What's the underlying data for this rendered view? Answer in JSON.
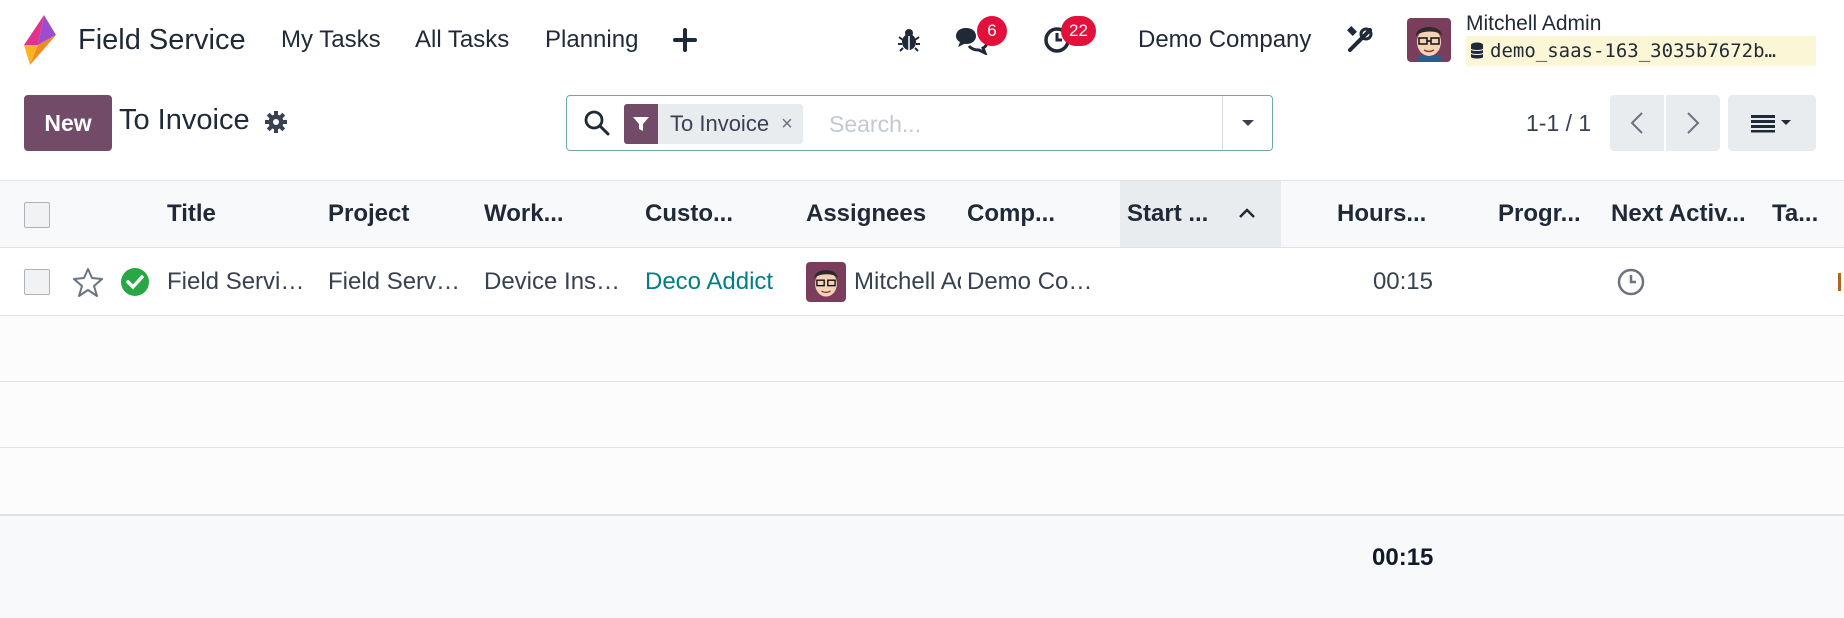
{
  "navbar": {
    "app_name": "Field Service",
    "menu": [
      "My Tasks",
      "All Tasks",
      "Planning"
    ],
    "messages_count": "6",
    "activities_count": "22",
    "company": "Demo Company",
    "user_name": "Mitchell Admin",
    "database": "demo_saas-163_3035b7672b…"
  },
  "control": {
    "new_label": "New",
    "title": "To Invoice",
    "facet_label": "To Invoice",
    "facet_remove": "×",
    "search_placeholder": "Search...",
    "pager": "1-1 / 1"
  },
  "list": {
    "columns": [
      "Title",
      "Project",
      "Work...",
      "Custo...",
      "Assignees",
      "Comp...",
      "Start ...",
      "Hours...",
      "Progr...",
      "Next Activ...",
      "Ta..."
    ],
    "rows": [
      {
        "title": "Field Servi…",
        "project": "Field Serv…",
        "worksheet": "Device Ins…",
        "customer": "Deco Addict",
        "assignee": "Mitchell Admin",
        "company": "Demo Co…",
        "start": "",
        "hours": "00:15",
        "progress": "",
        "next_activity": "",
        "tags": ""
      }
    ],
    "total_hours": "00:15"
  },
  "colors": {
    "brand": "#714b67",
    "link": "#017e84",
    "badge": "#e3103b",
    "success": "#28a745"
  }
}
